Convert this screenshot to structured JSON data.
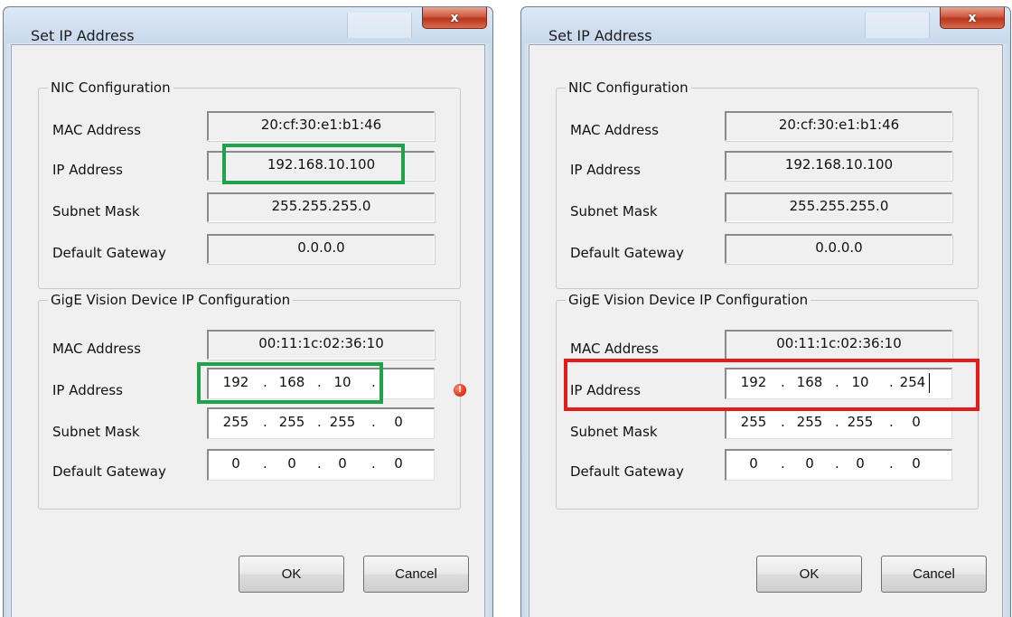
{
  "dialogs": {
    "left": {
      "title": "Set IP Address",
      "close_glyph": "x",
      "nic": {
        "group_title": "NIC Configuration",
        "mac_label": "MAC Address",
        "mac_value": "20:cf:30:e1:b1:46",
        "ip_label": "IP Address",
        "ip_value": "192.168.10.100",
        "subnet_label": "Subnet Mask",
        "subnet_value": "255.255.255.0",
        "gateway_label": "Default Gateway",
        "gateway_value": "0.0.0.0"
      },
      "device": {
        "group_title": "GigE Vision Device IP Configuration",
        "mac_label": "MAC Address",
        "mac_value": "00:11:1c:02:36:10",
        "ip_label": "IP Address",
        "ip_octets": [
          "192",
          "168",
          "10",
          ""
        ],
        "subnet_label": "Subnet Mask",
        "subnet_octets": [
          "255",
          "255",
          "255",
          "0"
        ],
        "gateway_label": "Default Gateway",
        "gateway_octets": [
          "0",
          "0",
          "0",
          "0"
        ],
        "warning_icon": "error-icon",
        "warning_glyph": "!"
      },
      "ok_label": "OK",
      "cancel_label": "Cancel",
      "highlight_color": "#1ea24a"
    },
    "right": {
      "title": "Set IP Address",
      "close_glyph": "x",
      "nic": {
        "group_title": "NIC Configuration",
        "mac_label": "MAC Address",
        "mac_value": "20:cf:30:e1:b1:46",
        "ip_label": "IP Address",
        "ip_value": "192.168.10.100",
        "subnet_label": "Subnet Mask",
        "subnet_value": "255.255.255.0",
        "gateway_label": "Default Gateway",
        "gateway_value": "0.0.0.0"
      },
      "device": {
        "group_title": "GigE Vision Device IP Configuration",
        "mac_label": "MAC Address",
        "mac_value": "00:11:1c:02:36:10",
        "ip_label": "IP Address",
        "ip_octets": [
          "192",
          "168",
          "10",
          "254"
        ],
        "subnet_label": "Subnet Mask",
        "subnet_octets": [
          "255",
          "255",
          "255",
          "0"
        ],
        "gateway_label": "Default Gateway",
        "gateway_octets": [
          "0",
          "0",
          "0",
          "0"
        ]
      },
      "ok_label": "OK",
      "cancel_label": "Cancel",
      "highlight_color": "#e41b1b"
    }
  }
}
